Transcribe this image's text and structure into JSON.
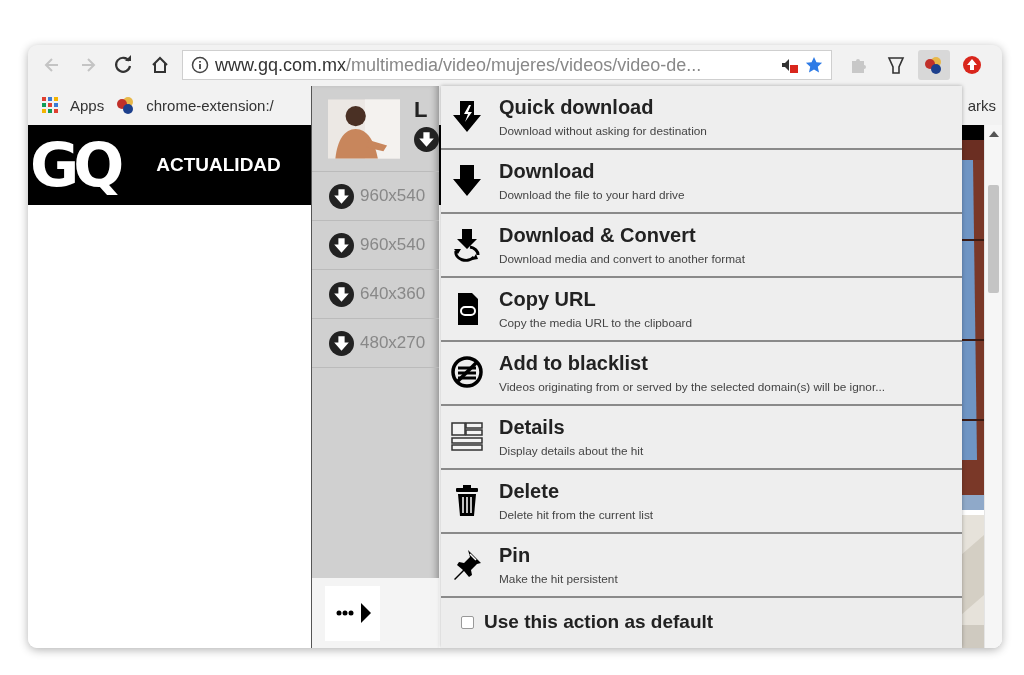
{
  "toolbar": {
    "nav_buttons": [
      {
        "kind": "back",
        "disabled": true
      },
      {
        "kind": "forward",
        "disabled": true
      },
      {
        "kind": "reload",
        "disabled": false
      },
      {
        "kind": "home",
        "disabled": false
      }
    ],
    "address_bar": {
      "domain": "www.gq.com.mx",
      "path": "/multimedia/video/mujeres/videos/video-de..."
    },
    "extensions": [
      {
        "kind": "puzzle",
        "selected": false
      },
      {
        "kind": "funnel",
        "selected": false
      },
      {
        "kind": "balls",
        "selected": true
      },
      {
        "kind": "upload",
        "selected": false
      }
    ]
  },
  "bookmarks_bar": {
    "items": [
      {
        "kind": "apps",
        "label": "Apps"
      },
      {
        "kind": "balls",
        "label": "chrome-extension:/"
      }
    ],
    "other_label": "arks"
  },
  "page": {
    "logo": "GQ",
    "nav_item": "ACTUALIDAD"
  },
  "popup": {
    "hit_title": "L",
    "variants": [
      {
        "label": "960x540"
      },
      {
        "label": "960x540"
      },
      {
        "label": "640x360"
      },
      {
        "label": "480x270"
      }
    ],
    "actions": [
      {
        "kind": "quick",
        "title": "Quick download",
        "description": "Download without asking for destination"
      },
      {
        "kind": "download",
        "title": "Download",
        "description": "Download the file to your hard drive"
      },
      {
        "kind": "convert",
        "title": "Download & Convert",
        "description": "Download media and convert to another format"
      },
      {
        "kind": "copy",
        "title": "Copy URL",
        "description": "Copy the media URL to the clipboard"
      },
      {
        "kind": "blacklist",
        "title": "Add to blacklist",
        "description": "Videos originating from or served by the selected domain(s) will be ignor..."
      },
      {
        "kind": "details",
        "title": "Details",
        "description": "Display details about the hit"
      },
      {
        "kind": "delete",
        "title": "Delete",
        "description": "Delete hit from the current list"
      },
      {
        "kind": "pin",
        "title": "Pin",
        "description": "Make the hit persistent"
      }
    ],
    "default_option": {
      "label": "Use this action as default",
      "checked": false
    }
  }
}
